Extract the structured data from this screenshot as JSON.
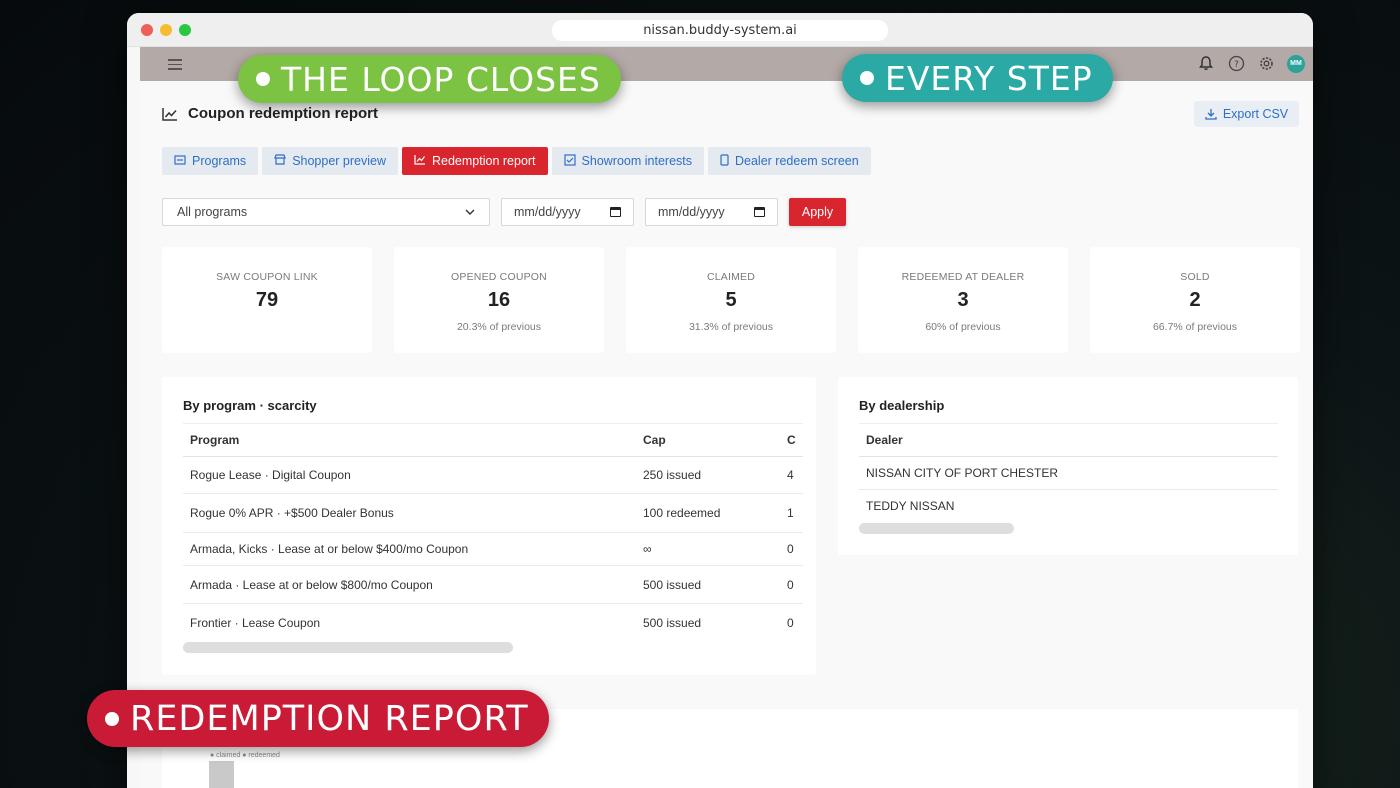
{
  "browser": {
    "url": "nissan.buddy-system.ai"
  },
  "header": {
    "avatar_initials": "MM",
    "icons": [
      "menu-icon",
      "bell-icon",
      "help-icon",
      "gear-icon"
    ]
  },
  "page": {
    "title": "Coupon redemption report",
    "export_label": "Export CSV"
  },
  "tabs": [
    {
      "label": "Programs",
      "icon": "list-icon",
      "active": false
    },
    {
      "label": "Shopper preview",
      "icon": "store-icon",
      "active": false
    },
    {
      "label": "Redemption report",
      "icon": "chart-icon",
      "active": true
    },
    {
      "label": "Showroom interests",
      "icon": "checkbox-icon",
      "active": false
    },
    {
      "label": "Dealer redeem screen",
      "icon": "phone-icon",
      "active": false
    }
  ],
  "filters": {
    "program_select": "All programs",
    "date_from": "mm/dd/yyyy",
    "date_to": "mm/dd/yyyy",
    "apply_label": "Apply"
  },
  "stats": [
    {
      "label": "SAW COUPON LINK",
      "value": "79",
      "sub": ""
    },
    {
      "label": "OPENED COUPON",
      "value": "16",
      "sub": "20.3% of previous"
    },
    {
      "label": "CLAIMED",
      "value": "5",
      "sub": "31.3% of previous"
    },
    {
      "label": "REDEEMED AT DEALER",
      "value": "3",
      "sub": "60% of previous"
    },
    {
      "label": "SOLD",
      "value": "2",
      "sub": "66.7% of previous"
    }
  ],
  "by_program": {
    "title": "By program · scarcity",
    "columns": [
      "Program",
      "Cap",
      "C"
    ],
    "rows": [
      [
        "Rogue Lease · Digital Coupon",
        "250 issued",
        "4"
      ],
      [
        "Rogue 0% APR · +$500 Dealer Bonus",
        "100 redeemed",
        "1"
      ],
      [
        "Armada, Kicks · Lease at or below $400/mo Coupon",
        "∞",
        "0"
      ],
      [
        "Armada · Lease at or below $800/mo Coupon",
        "500 issued",
        "0"
      ],
      [
        "Frontier · Lease Coupon",
        "500 issued",
        "0"
      ]
    ]
  },
  "by_dealership": {
    "title": "By dealership",
    "columns": [
      "Dealer"
    ],
    "rows": [
      "NISSAN CITY OF PORT CHESTER",
      "TEDDY NISSAN"
    ]
  },
  "bottom_panel": {
    "legend": "● claimed ● redeemed"
  },
  "overlays": {
    "loop": "THE LOOP CLOSES",
    "step": "EVERY STEP",
    "redemption": "REDEMPTION REPORT"
  },
  "colors": {
    "accent_red": "#d9262e",
    "link_blue": "#2d6fc4",
    "badge_green": "#7cc243",
    "badge_teal": "#2aa9a5",
    "badge_red": "#c91a36"
  }
}
